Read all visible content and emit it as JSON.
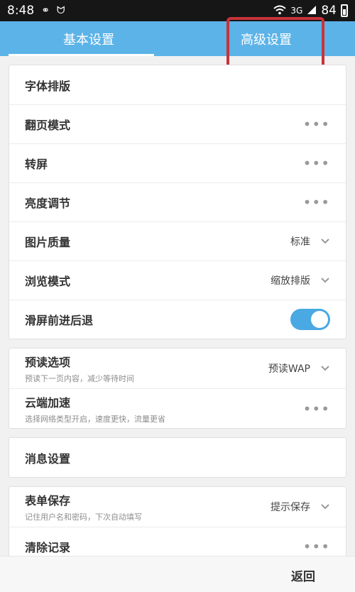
{
  "status_bar": {
    "time": "8:48",
    "network": "3G",
    "battery": "84",
    "icons": [
      "circles-icon",
      "bird-icon",
      "wifi-icon",
      "signal-icon",
      "battery-icon"
    ]
  },
  "tabs": [
    {
      "label": "基本设置",
      "active": true
    },
    {
      "label": "高级设置",
      "active": false
    }
  ],
  "groups": {
    "display": [
      {
        "label": "字体排版"
      },
      {
        "label": "翻页模式",
        "icon": "more-icon"
      },
      {
        "label": "转屏",
        "icon": "more-icon"
      },
      {
        "label": "亮度调节",
        "icon": "more-icon"
      },
      {
        "label": "图片质量",
        "value": "标准",
        "icon": "chevron-down-icon"
      },
      {
        "label": "浏览模式",
        "value": "缩放排版",
        "icon": "chevron-down-icon"
      },
      {
        "label": "滑屏前进后退",
        "toggle": true
      }
    ],
    "network": [
      {
        "label": "预读选项",
        "sub": "预读下一页内容，减少等待时间",
        "value": "预读WAP",
        "icon": "chevron-down-icon"
      },
      {
        "label": "云端加速",
        "sub": "选择网络类型开启，速度更快，流量更省",
        "icon": "more-icon"
      }
    ],
    "message": [
      {
        "label": "消息设置"
      }
    ],
    "form": [
      {
        "label": "表单保存",
        "sub": "记住用户名和密码，下次自动填写",
        "value": "提示保存",
        "icon": "chevron-down-icon"
      },
      {
        "label": "清除记录",
        "icon": "more-icon"
      }
    ]
  },
  "bottom": {
    "back_label": "返回"
  },
  "colors": {
    "accent": "#5cb3e8",
    "toggle_on": "#4aa8e3",
    "annotation": "#c8333a"
  }
}
